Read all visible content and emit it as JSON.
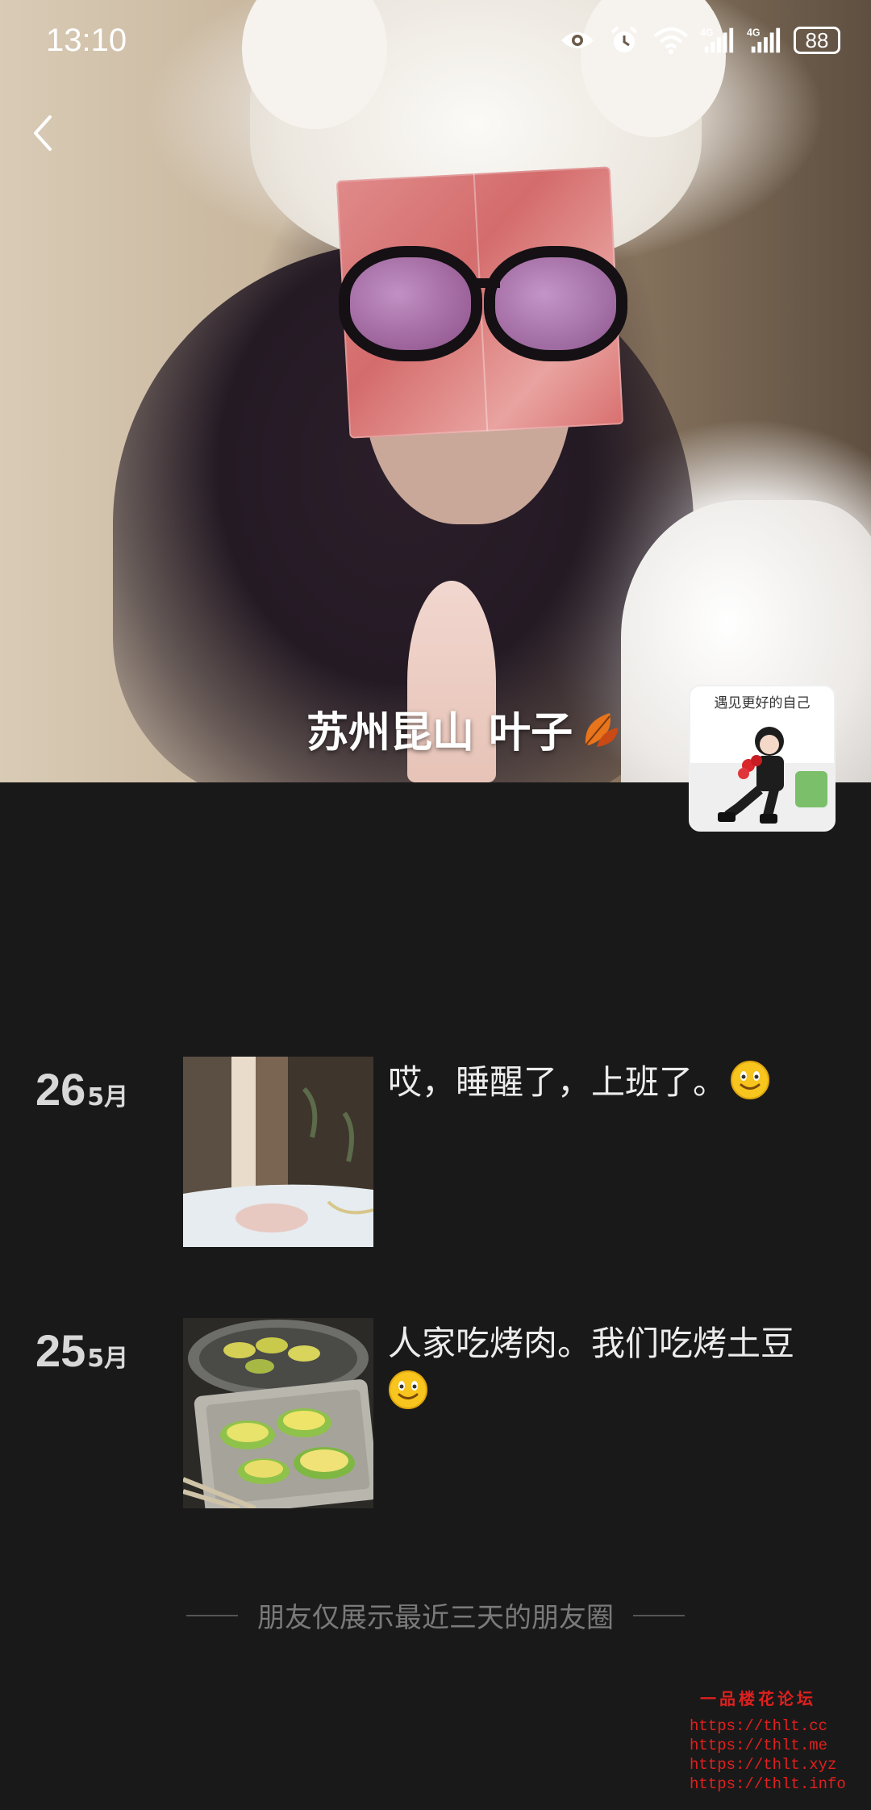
{
  "status_bar": {
    "time": "13:10",
    "battery": "88",
    "icons": [
      "eye-icon",
      "alarm-icon",
      "wifi-icon",
      "signal-4g-icon",
      "signal-4g-icon"
    ]
  },
  "profile": {
    "nickname": "苏州昆山 叶子",
    "avatar_caption": "遇见更好的自己"
  },
  "posts": [
    {
      "day": "26",
      "month": "5月",
      "text": "哎，睡醒了，上班了。"
    },
    {
      "day": "25",
      "month": "5月",
      "text": "人家吃烤肉。我们吃烤土豆"
    }
  ],
  "footer_note": "朋友仅展示最近三天的朋友圈",
  "watermark": {
    "title": "一品楼花论坛",
    "urls": [
      "https://thlt.cc",
      "https://thlt.me",
      "https://thlt.xyz",
      "https://thlt.info"
    ]
  },
  "colors": {
    "background": "#191919",
    "text": "#ececec",
    "watermark": "#e0201e"
  }
}
